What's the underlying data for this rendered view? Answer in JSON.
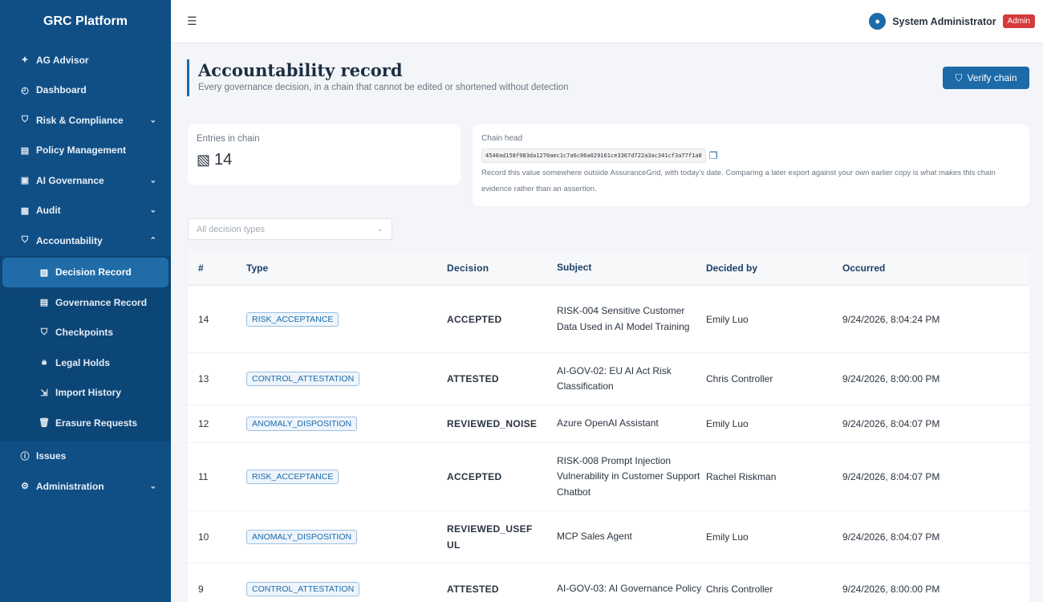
{
  "app": {
    "title": "GRC Platform"
  },
  "sidebar": {
    "items": [
      {
        "label": "AG Advisor",
        "icon": "sparkle-icon"
      },
      {
        "label": "Dashboard",
        "icon": "dashboard-icon"
      },
      {
        "label": "Risk & Compliance",
        "icon": "shield-icon",
        "expandable": true
      },
      {
        "label": "Policy Management",
        "icon": "document-icon"
      },
      {
        "label": "AI Governance",
        "icon": "ai-chip-icon",
        "expandable": true
      },
      {
        "label": "Audit",
        "icon": "audit-icon",
        "expandable": true
      },
      {
        "label": "Accountability",
        "icon": "shield-icon",
        "expanded": true
      }
    ],
    "accountability_sub": [
      {
        "label": "Decision Record",
        "icon": "record-icon",
        "active": true
      },
      {
        "label": "Governance Record",
        "icon": "document-icon"
      },
      {
        "label": "Checkpoints",
        "icon": "shield-check-icon"
      },
      {
        "label": "Legal Holds",
        "icon": "lock-icon"
      },
      {
        "label": "Import History",
        "icon": "import-icon"
      },
      {
        "label": "Erasure Requests",
        "icon": "trash-icon"
      }
    ],
    "bottom_items": [
      {
        "label": "Issues",
        "icon": "info-icon"
      },
      {
        "label": "Administration",
        "icon": "gear-icon",
        "expandable": true
      }
    ]
  },
  "topbar": {
    "user_name": "System Administrator",
    "role": "Admin"
  },
  "page": {
    "title": "Accountability record",
    "subtitle": "Every governance decision, in a chain that cannot be edited or shortened without detection",
    "verify_label": "Verify chain"
  },
  "entries": {
    "label": "Entries in chain",
    "value": "14"
  },
  "chain_head": {
    "label": "Chain head",
    "hash": "4540ad158f983da1270aec1c7a6c06a029161ce3367d722a3ac341cf3a77f1a8",
    "note": "Record this value somewhere outside AssuranceGrid, with today's date. Comparing a later export against your own earlier copy is what makes this chain evidence rather than an assertion."
  },
  "filter": {
    "placeholder": "All decision types"
  },
  "table": {
    "columns": [
      "#",
      "Type",
      "Decision",
      "Subject",
      "Decided by",
      "Occurred"
    ],
    "rows": [
      {
        "num": "14",
        "type": "RISK_ACCEPTANCE",
        "decision": "ACCEPTED",
        "subject": "RISK-004 Sensitive Customer Data Used in AI Model Training",
        "by": "Emily Luo",
        "occurred": "9/24/2026, 8:04:24 PM"
      },
      {
        "num": "13",
        "type": "CONTROL_ATTESTATION",
        "decision": "ATTESTED",
        "subject": "AI-GOV-02: EU AI Act Risk Classification",
        "by": "Chris Controller",
        "occurred": "9/24/2026, 8:00:00 PM"
      },
      {
        "num": "12",
        "type": "ANOMALY_DISPOSITION",
        "decision": "REVIEWED_NOISE",
        "subject": "Azure OpenAI Assistant",
        "by": "Emily Luo",
        "occurred": "9/24/2026, 8:04:07 PM"
      },
      {
        "num": "11",
        "type": "RISK_ACCEPTANCE",
        "decision": "ACCEPTED",
        "subject": "RISK-008 Prompt Injection Vulnerability in Customer Support Chatbot",
        "by": "Rachel Riskman",
        "occurred": "9/24/2026, 8:04:07 PM"
      },
      {
        "num": "10",
        "type": "ANOMALY_DISPOSITION",
        "decision": "REVIEWED_USEFUL",
        "subject": "MCP Sales Agent",
        "by": "Emily Luo",
        "occurred": "9/24/2026, 8:04:07 PM"
      },
      {
        "num": "9",
        "type": "CONTROL_ATTESTATION",
        "decision": "ATTESTED",
        "subject": "AI-GOV-03: AI Governance Policy",
        "by": "Chris Controller",
        "occurred": "9/24/2026, 8:00:00 PM"
      }
    ]
  }
}
